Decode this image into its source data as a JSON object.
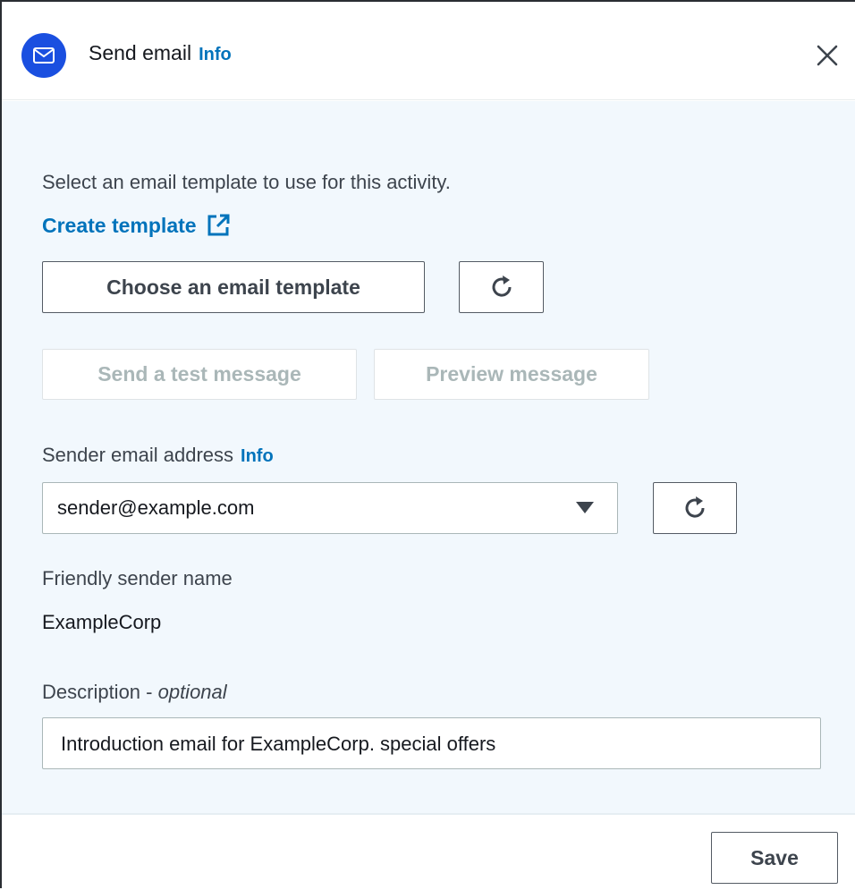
{
  "header": {
    "title": "Send email",
    "info_label": "Info",
    "icon": "mail-icon",
    "close_icon": "close-icon",
    "accent_color": "#1a4fe0"
  },
  "template_section": {
    "description": "Select an email template to use for this activity.",
    "create_template_label": "Create template",
    "external_link_icon": "external-link-icon",
    "choose_button_label": "Choose an email template",
    "refresh_icon": "refresh-icon",
    "send_test_label": "Send a test message",
    "preview_label": "Preview message"
  },
  "sender": {
    "label": "Sender email address",
    "info_label": "Info",
    "selected_value": "sender@example.com",
    "caret_icon": "caret-down-icon",
    "refresh_icon": "refresh-icon"
  },
  "friendly_name": {
    "label": "Friendly sender name",
    "value": "ExampleCorp"
  },
  "description_field": {
    "label": "Description - ",
    "optional_label": "optional",
    "value": "Introduction email for ExampleCorp. special offers"
  },
  "footer": {
    "save_label": "Save"
  },
  "colors": {
    "link": "#0073bb",
    "body_background": "#f2f8fd",
    "disabled_text": "#aab7b8"
  }
}
